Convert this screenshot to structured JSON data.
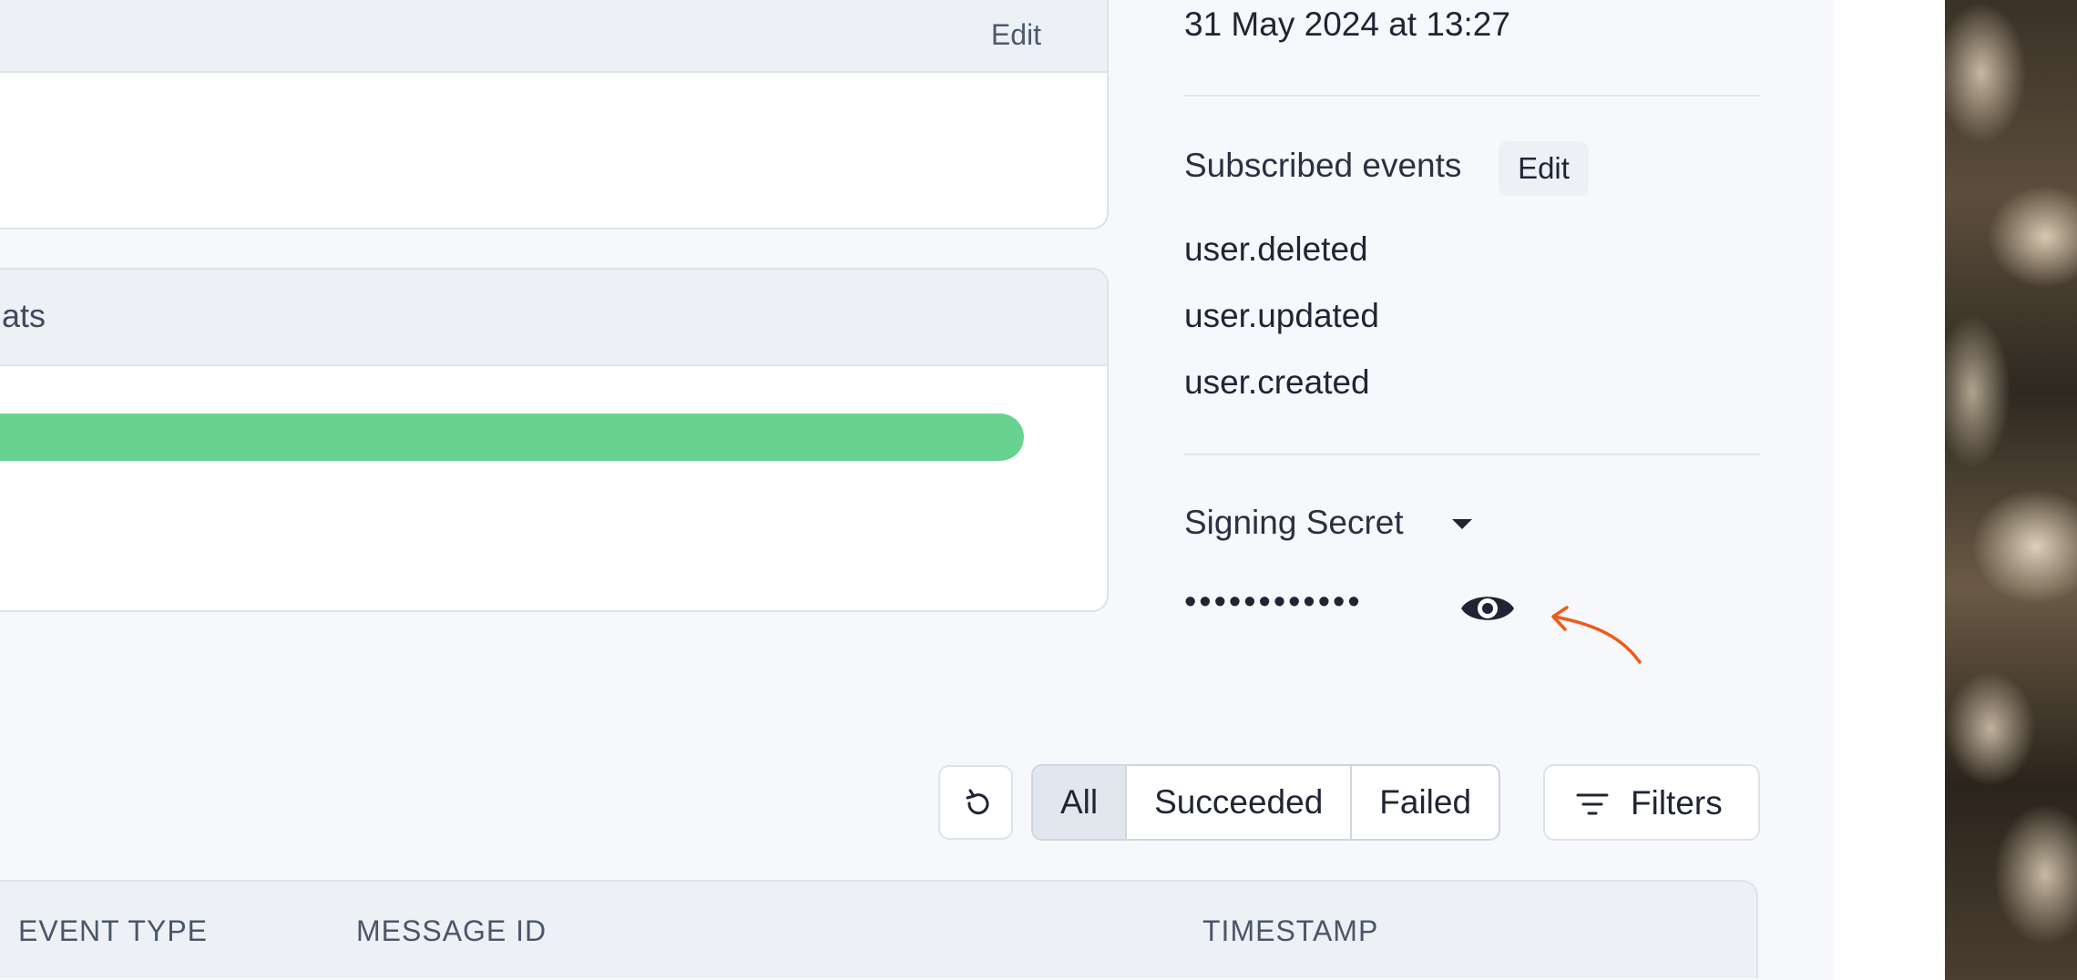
{
  "details_card": {
    "edit_label": "Edit"
  },
  "stats_card": {
    "title": "ats",
    "progress_fraction": 1.0,
    "progress_color": "#68d391"
  },
  "sidebar": {
    "created_date": "31 May 2024 at 13:27",
    "subscribed_events": {
      "title": "Subscribed events",
      "edit_label": "Edit",
      "items": [
        "user.deleted",
        "user.updated",
        "user.created"
      ]
    },
    "signing_secret": {
      "title": "Signing Secret",
      "masked_value": "••••••••••••",
      "reveal_icon": "eye-icon",
      "dropdown_icon": "caret-down-icon",
      "hint_icon": "arrow-annotation-icon",
      "hint_color": "#f05a1a"
    }
  },
  "toolbar": {
    "refresh_icon": "refresh-icon",
    "tabs": [
      {
        "label": "All",
        "active": true
      },
      {
        "label": "Succeeded",
        "active": false
      },
      {
        "label": "Failed",
        "active": false
      }
    ],
    "filters_label": "Filters",
    "filters_icon": "filter-icon"
  },
  "table": {
    "columns": [
      "EVENT TYPE",
      "MESSAGE ID",
      "TIMESTAMP"
    ]
  }
}
